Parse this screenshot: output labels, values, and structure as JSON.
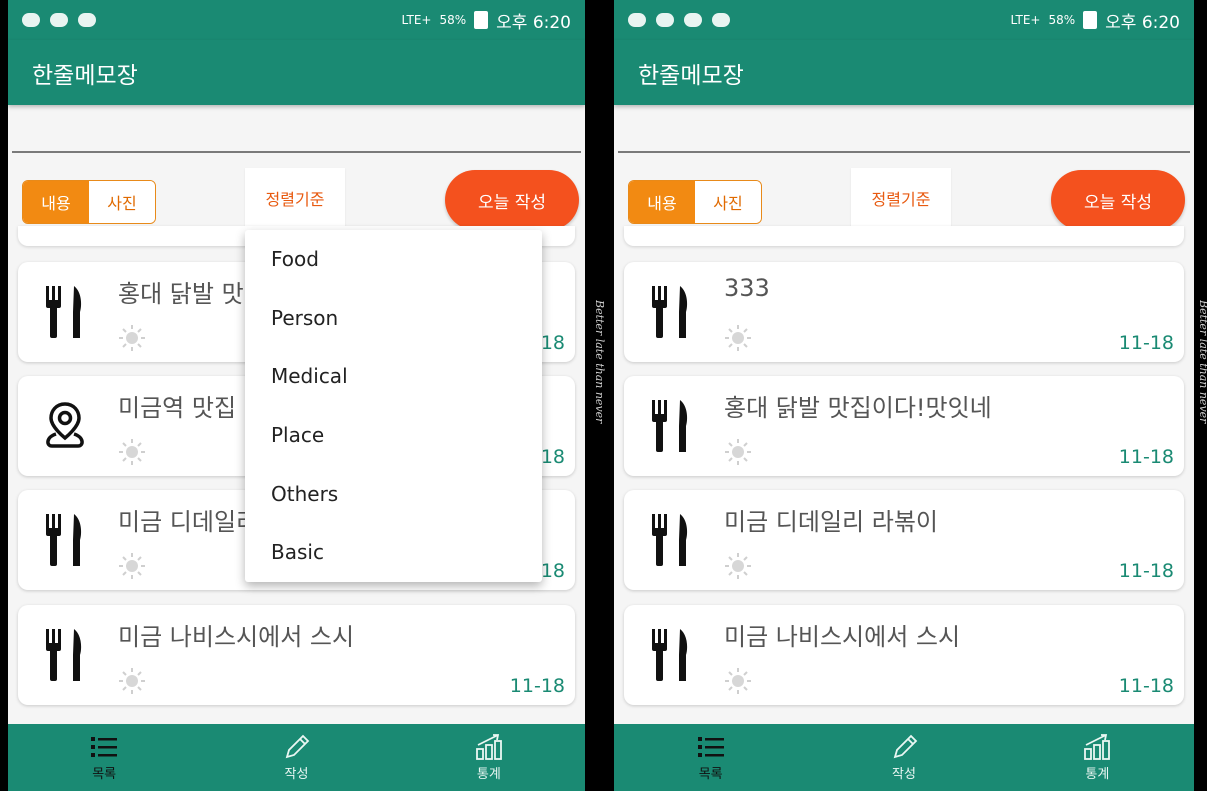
{
  "screens": [
    {
      "status": {
        "battery": "58%",
        "network": "LTE+",
        "time": "오후 6:20"
      },
      "app_title": "한줄메모장",
      "toggle": {
        "content_label": "내용",
        "photo_label": "사진"
      },
      "sort_label": "정렬기준",
      "write_today_label": "오늘 작성",
      "memos": [
        {
          "title": "홍대 닭발 맛집이다!맛잇네",
          "date": "11-18",
          "category_icon": "fork-knife-icon"
        },
        {
          "title": "미금역 맛집",
          "date": "11-18",
          "category_icon": "map-pin-icon"
        },
        {
          "title": "미금 디데일리 라볶이",
          "date": "11-18",
          "category_icon": "fork-knife-icon"
        },
        {
          "title": "미금 나비스시에서 스시",
          "date": "11-18",
          "category_icon": "fork-knife-icon"
        }
      ],
      "dropdown_options": [
        "Food",
        "Person",
        "Medical",
        "Place",
        "Others",
        "Basic"
      ],
      "nav": {
        "list": "목록",
        "write": "작성",
        "stats": "통계"
      }
    },
    {
      "status": {
        "battery": "58%",
        "network": "LTE+",
        "time": "오후 6:20"
      },
      "app_title": "한줄메모장",
      "toggle": {
        "content_label": "내용",
        "photo_label": "사진"
      },
      "sort_label": "정렬기준",
      "write_today_label": "오늘 작성",
      "memos": [
        {
          "title": "333",
          "date": "11-18",
          "category_icon": "fork-knife-icon"
        },
        {
          "title": "홍대 닭발 맛집이다!맛잇네",
          "date": "11-18",
          "category_icon": "fork-knife-icon"
        },
        {
          "title": "미금 디데일리 라볶이",
          "date": "11-18",
          "category_icon": "fork-knife-icon"
        },
        {
          "title": "미금 나비스시에서 스시",
          "date": "11-18",
          "category_icon": "fork-knife-icon"
        }
      ],
      "nav": {
        "list": "목록",
        "write": "작성",
        "stats": "통계"
      }
    }
  ],
  "side_text": "Better late than never",
  "colors": {
    "primary": "#1a8a73",
    "accent": "#f4511e",
    "toggle_active": "#f28a12",
    "date": "#1a8a73"
  }
}
